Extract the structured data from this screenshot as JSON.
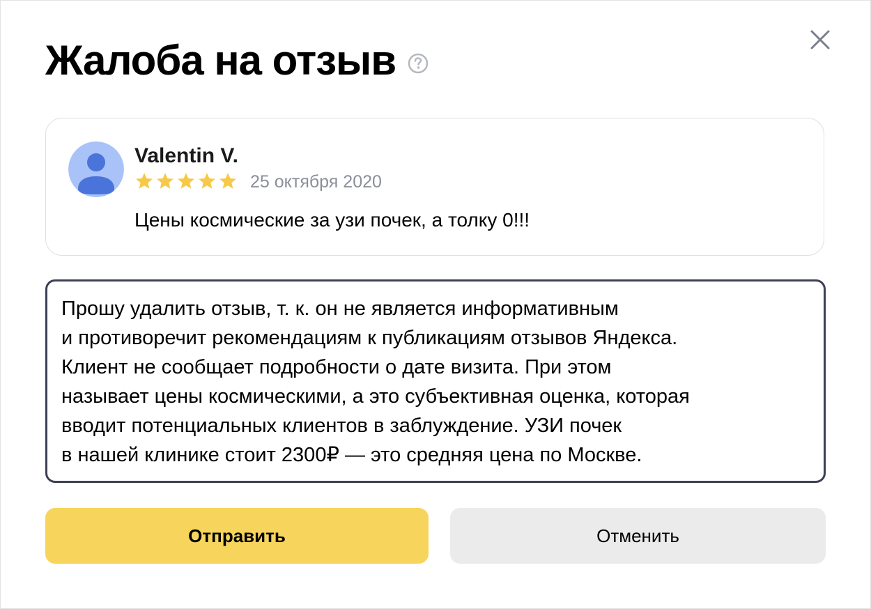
{
  "dialog": {
    "title": "Жалоба на отзыв",
    "help_icon": "question-circle-icon",
    "close_icon": "close-icon"
  },
  "review": {
    "author": "Valentin V.",
    "rating": 5,
    "rating_max": 5,
    "date": "25 октября 2020",
    "text": "Цены космические за узи почек, а толку 0!!!",
    "avatar_icon": "user-avatar-icon"
  },
  "complaint": {
    "text": "Прошу удалить отзыв, т. к. он не является информативным\nи противоречит рекомендациям к публикациям отзывов Яндекса.\nКлиент не сообщает подробности о дате визита. При этом\nназывает цены космическими, а это субъективная оценка, которая\nвводит потенциальных клиентов в заблуждение. УЗИ почек\nв нашей клинике стоит 2300₽ — это средняя цена по Москве."
  },
  "buttons": {
    "submit_label": "Отправить",
    "cancel_label": "Отменить"
  },
  "colors": {
    "submit_bg": "#f7d55c",
    "cancel_bg": "#ebebeb",
    "star": "#f7c948",
    "textarea_border": "#3c3f55",
    "avatar_bg": "#a9c2f7",
    "avatar_fg": "#4a74d9"
  }
}
